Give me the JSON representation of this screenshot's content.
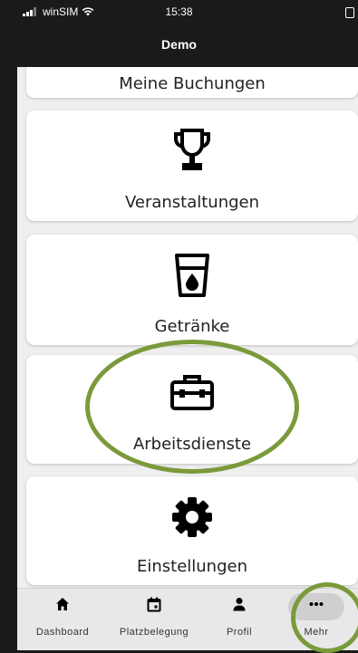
{
  "status_bar": {
    "carrier": "winSIM",
    "time": "15:38"
  },
  "header": {
    "title": "Demo"
  },
  "menu": {
    "items": [
      {
        "label": "Meine Buchungen",
        "icon": "calendar-icon"
      },
      {
        "label": "Veranstaltungen",
        "icon": "trophy-icon"
      },
      {
        "label": "Getränke",
        "icon": "drink-icon"
      },
      {
        "label": "Arbeitsdienste",
        "icon": "toolbox-icon"
      },
      {
        "label": "Einstellungen",
        "icon": "gear-icon"
      }
    ]
  },
  "tab_bar": {
    "tabs": [
      {
        "label": "Dashboard",
        "icon": "home-icon"
      },
      {
        "label": "Platzbelegung",
        "icon": "calendar-icon"
      },
      {
        "label": "Profil",
        "icon": "person-icon"
      },
      {
        "label": "Mehr",
        "icon": "more-icon",
        "selected": true
      }
    ]
  },
  "colors": {
    "annotation": "#7a9a3b",
    "background": "#efefef",
    "card": "#ffffff"
  }
}
